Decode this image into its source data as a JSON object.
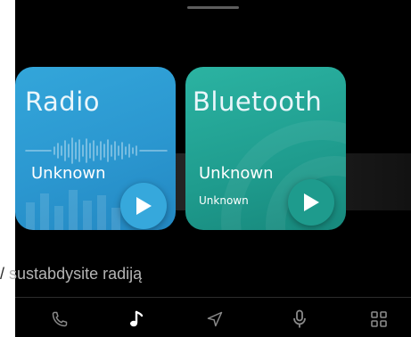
{
  "cards": [
    {
      "title": "Radio",
      "subtitle": "Unknown",
      "color": "#2b97d0"
    },
    {
      "title": "Bluetooth",
      "subtitle": "Unknown",
      "detail": "Unknown",
      "color": "#1f9c8e"
    }
  ],
  "caption": {
    "prefix": "/",
    "text": "sustabdysite radiją"
  },
  "nav": [
    "phone-icon",
    "music-icon",
    "navigation-icon",
    "microphone-icon",
    "apps-grid-icon"
  ],
  "colors": {
    "background": "#000000",
    "nav_active": "#ffffff",
    "nav_inactive": "#8a8a8a"
  }
}
